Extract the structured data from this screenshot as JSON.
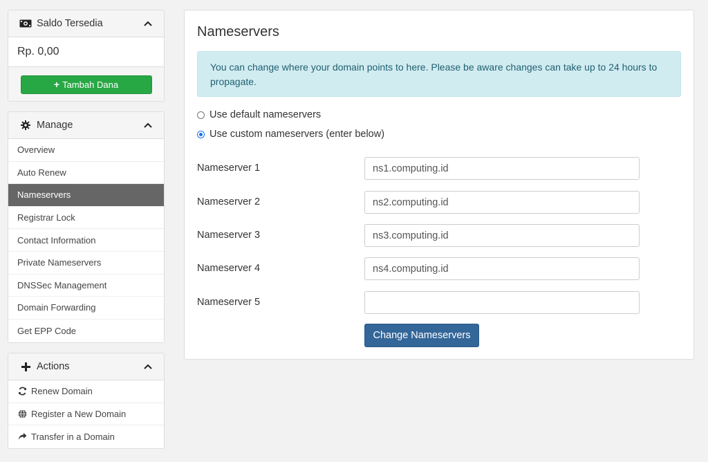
{
  "balance": {
    "title": "Saldo Tersedia",
    "icon": "money-icon",
    "amount": "Rp. 0,00",
    "add_funds_label": "Tambah Dana",
    "button_color": "#28a745"
  },
  "manage": {
    "title": "Manage",
    "icon": "gear-icon",
    "items": [
      {
        "label": "Overview",
        "active": false
      },
      {
        "label": "Auto Renew",
        "active": false
      },
      {
        "label": "Nameservers",
        "active": true
      },
      {
        "label": "Registrar Lock",
        "active": false
      },
      {
        "label": "Contact Information",
        "active": false
      },
      {
        "label": "Private Nameservers",
        "active": false
      },
      {
        "label": "DNSSec Management",
        "active": false
      },
      {
        "label": "Domain Forwarding",
        "active": false
      },
      {
        "label": "Get EPP Code",
        "active": false
      }
    ]
  },
  "actions": {
    "title": "Actions",
    "icon": "plus-icon",
    "items": [
      {
        "label": "Renew Domain",
        "icon": "refresh-icon"
      },
      {
        "label": "Register a New Domain",
        "icon": "globe-icon"
      },
      {
        "label": "Transfer in a Domain",
        "icon": "share-icon"
      }
    ]
  },
  "main": {
    "title": "Nameservers",
    "alert": "You can change where your domain points to here. Please be aware changes can take up to 24 hours to propagate.",
    "alert_color": "#d1ecf1",
    "options": [
      {
        "label": "Use default nameservers",
        "checked": false
      },
      {
        "label": "Use custom nameservers (enter below)",
        "checked": true
      }
    ],
    "nameservers": [
      {
        "label": "Nameserver 1",
        "value": "ns1.computing.id"
      },
      {
        "label": "Nameserver 2",
        "value": "ns2.computing.id"
      },
      {
        "label": "Nameserver 3",
        "value": "ns3.computing.id"
      },
      {
        "label": "Nameserver 4",
        "value": "ns4.computing.id"
      },
      {
        "label": "Nameserver 5",
        "value": ""
      }
    ],
    "submit_label": "Change Nameservers",
    "submit_color": "#336699"
  }
}
